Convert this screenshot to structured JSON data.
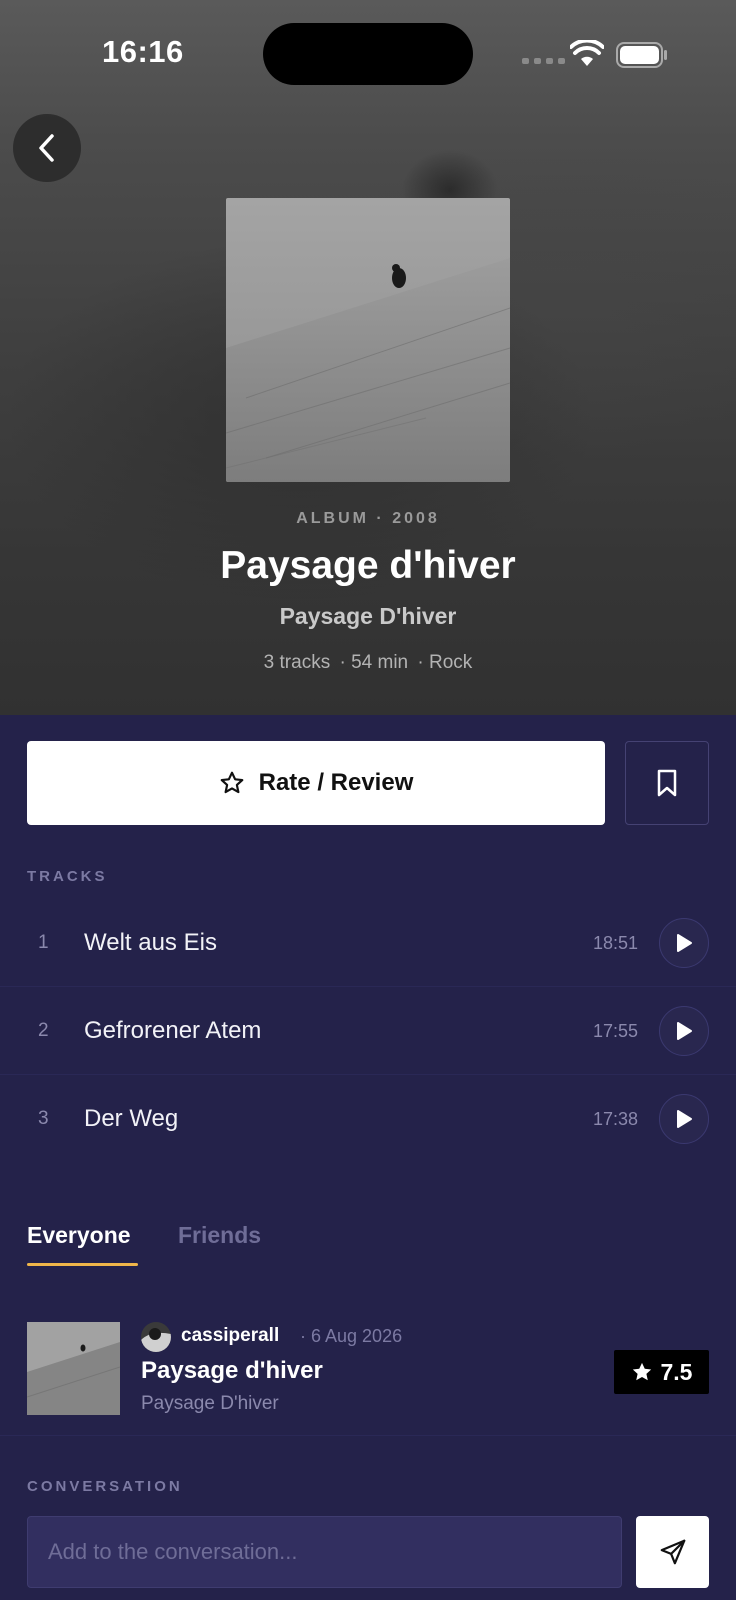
{
  "status_bar": {
    "time": "16:16"
  },
  "album": {
    "meta": "ALBUM · 2008",
    "title": "Paysage d'hiver",
    "artist": "Paysage D'hiver",
    "tracks_count": "3 tracks",
    "duration": "· 54 min",
    "genre": "· Rock"
  },
  "actions": {
    "rate_label": "Rate / Review"
  },
  "tracks_section": {
    "label": "TRACKS",
    "items": [
      {
        "number": "1",
        "title": "Welt aus Eis",
        "duration": "18:51"
      },
      {
        "number": "2",
        "title": "Gefrorener Atem",
        "duration": "17:55"
      },
      {
        "number": "3",
        "title": "Der Weg",
        "duration": "17:38"
      }
    ]
  },
  "tabs": {
    "everyone": "Everyone",
    "friends": "Friends"
  },
  "review": {
    "user": "cassiperall",
    "date": "· 6 Aug 2026",
    "album_title": "Paysage d'hiver",
    "artist": "Paysage D'hiver",
    "rating": "7.5"
  },
  "conversation": {
    "label": "CONVERSATION",
    "placeholder": "Add to the conversation..."
  },
  "colors": {
    "accent_underline": "#f0b64a",
    "background": "#24224a"
  }
}
